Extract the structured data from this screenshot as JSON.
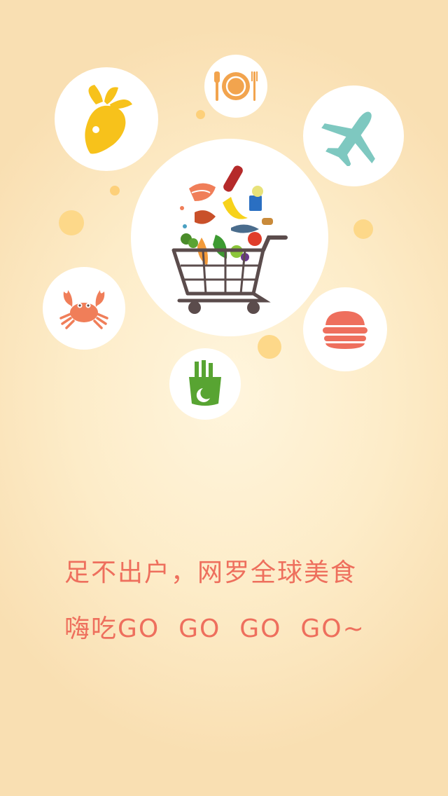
{
  "slogan": {
    "line1": "足不出户，网罗全球美食",
    "line2": "嗨吃GO  GO  GO  GO~"
  },
  "icons": {
    "center": "shopping-cart-groceries-icon",
    "top_left": "mango-icon",
    "top_center": "dinner-plate-icon",
    "top_right": "airplane-icon",
    "left": "crab-icon",
    "right": "burger-icon",
    "bottom": "drink-cup-icon"
  },
  "colors": {
    "slogan_text": "#ee6f5d",
    "mango": "#f7c21b",
    "plate": "#f2a44e",
    "airplane": "#7ec8c0",
    "crab": "#f07e59",
    "burger": "#ee6f5d",
    "drink": "#58a432",
    "cart": "#5b4c4c"
  }
}
